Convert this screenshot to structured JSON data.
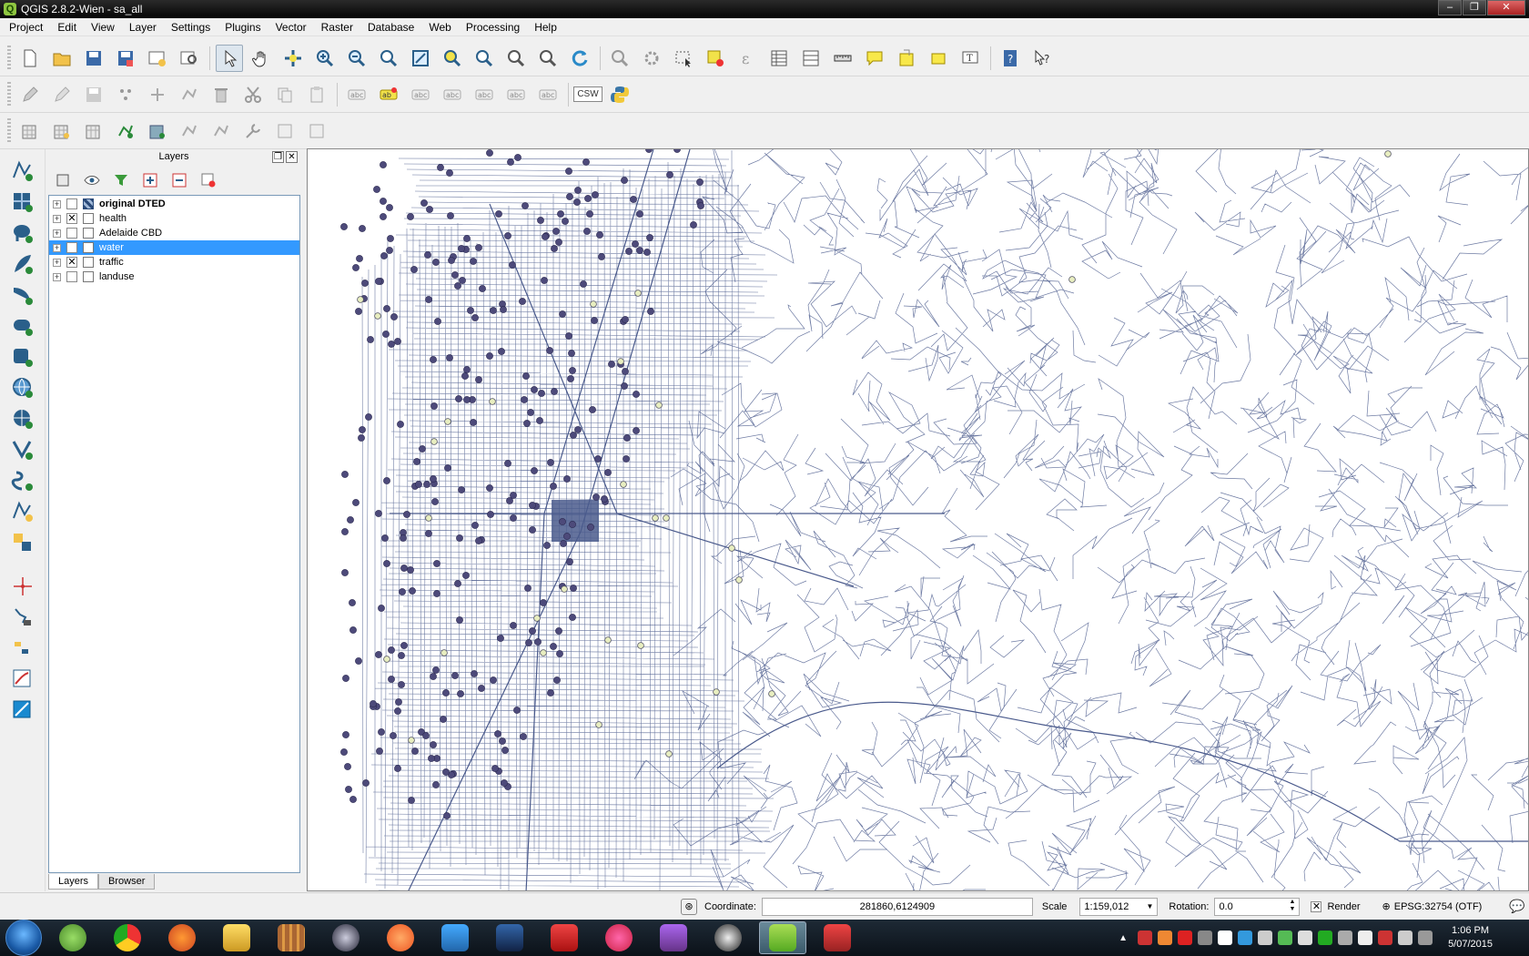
{
  "window": {
    "title": "QGIS 2.8.2-Wien - sa_all"
  },
  "menu": [
    "Project",
    "Edit",
    "View",
    "Layer",
    "Settings",
    "Plugins",
    "Vector",
    "Raster",
    "Database",
    "Web",
    "Processing",
    "Help"
  ],
  "toolbar": {
    "csw_label": "CSW"
  },
  "layers_panel": {
    "title": "Layers",
    "layers": [
      {
        "name": "original DTED",
        "checked": false,
        "bold": true,
        "type": "raster"
      },
      {
        "name": "health",
        "checked": true,
        "type": "vector"
      },
      {
        "name": "Adelaide CBD",
        "checked": false,
        "type": "vector"
      },
      {
        "name": "water",
        "checked": false,
        "selected": true,
        "type": "vector"
      },
      {
        "name": "traffic",
        "checked": true,
        "type": "vector"
      },
      {
        "name": "landuse",
        "checked": false,
        "type": "vector"
      }
    ],
    "tabs": [
      "Layers",
      "Browser"
    ]
  },
  "status": {
    "coordinate_label": "Coordinate:",
    "coordinate_value": "281860,6124909",
    "scale_label": "Scale",
    "scale_value": "1:159,012",
    "rotation_label": "Rotation:",
    "rotation_value": "0.0",
    "render_label": "Render",
    "render_checked": true,
    "crs": "EPSG:32754 (OTF)"
  },
  "taskbar": {
    "time": "1:06 PM",
    "date": "5/07/2015"
  },
  "colors": {
    "road": "#4a5a8c",
    "point": "#4d4a7a",
    "point_light": "#e8eec0",
    "selection": "#3399ff"
  }
}
